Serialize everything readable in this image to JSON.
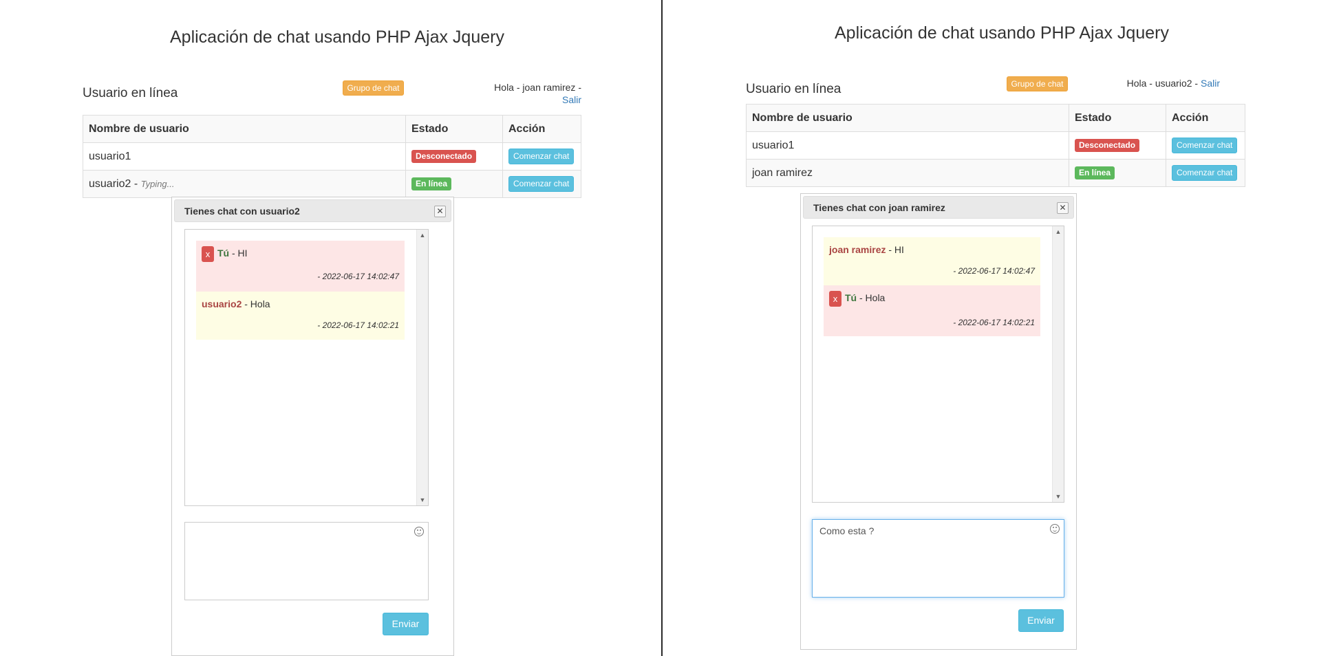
{
  "left": {
    "title": "Aplicación de chat usando PHP Ajax Jquery",
    "online_heading": "Usuario en línea",
    "group_chat_button": "Grupo de chat",
    "greeting_prefix": "Hola - joan ramirez -",
    "logout_link": "Salir",
    "table": {
      "headers": [
        "Nombre de usuario",
        "Estado",
        "Acción"
      ],
      "rows": [
        {
          "user": "usuario1",
          "typing": "",
          "status": "Desconectado",
          "status_type": "danger",
          "action": "Comenzar chat"
        },
        {
          "user": "usuario2",
          "typing": "Typing...",
          "status": "En línea",
          "status_type": "success",
          "action": "Comenzar chat"
        }
      ]
    },
    "dialog": {
      "title": "Tienes chat con usuario2",
      "messages": [
        {
          "mine": true,
          "delete": "x",
          "author": "Tú",
          "text": "- HI",
          "time": "- 2022-06-17 14:02:47"
        },
        {
          "mine": false,
          "author": "usuario2",
          "text": "- Hola",
          "time": "- 2022-06-17 14:02:21"
        }
      ],
      "compose_value": "",
      "send_button": "Enviar"
    }
  },
  "right": {
    "title": "Aplicación de chat usando PHP Ajax Jquery",
    "online_heading": "Usuario en línea",
    "group_chat_button": "Grupo de chat",
    "greeting_prefix": "Hola - usuario2 -",
    "logout_link": "Salir",
    "table": {
      "headers": [
        "Nombre de usuario",
        "Estado",
        "Acción"
      ],
      "rows": [
        {
          "user": "usuario1",
          "typing": "",
          "status": "Desconectado",
          "status_type": "danger",
          "action": "Comenzar chat"
        },
        {
          "user": "joan ramirez",
          "typing": "",
          "status": "En línea",
          "status_type": "success",
          "action": "Comenzar chat"
        }
      ]
    },
    "dialog": {
      "title": "Tienes chat con joan ramirez",
      "messages": [
        {
          "mine": false,
          "author": "joan ramirez",
          "text": "- HI",
          "time": "- 2022-06-17 14:02:47"
        },
        {
          "mine": true,
          "delete": "x",
          "author": "Tú",
          "text": "- Hola",
          "time": "- 2022-06-17 14:02:21"
        }
      ],
      "compose_value": "Como esta ?",
      "send_button": "Enviar"
    }
  },
  "colors": {
    "status_danger": "#d9534f",
    "status_success": "#5cb85c",
    "info_button": "#5bc0de",
    "warning_button": "#f0ad4e",
    "link": "#337ab7",
    "my_message_bg": "#fde6e6",
    "their_message_bg": "#fefde4"
  },
  "icons": {
    "close": "close-icon",
    "emoji": "smiley-icon",
    "scroll_up": "scroll-up-icon",
    "scroll_down": "scroll-down-icon"
  }
}
